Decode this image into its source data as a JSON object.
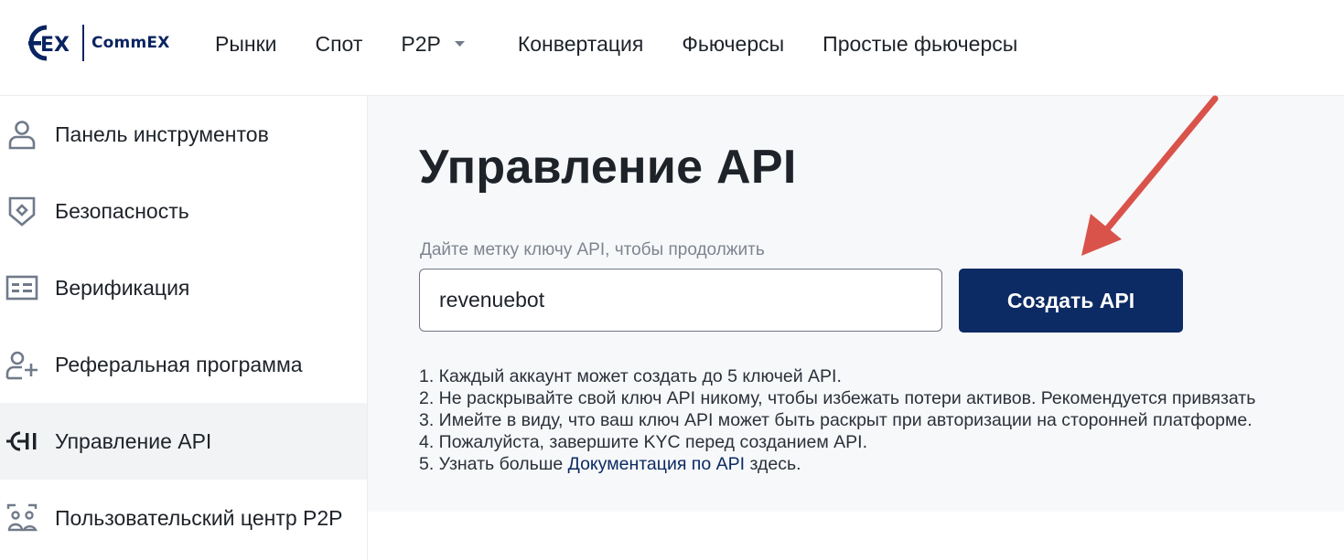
{
  "brand": {
    "logo_text": "CommEX",
    "logo_mark": "EX"
  },
  "nav": {
    "items": [
      "Рынки",
      "Спот",
      "P2P",
      "Конвертация",
      "Фьючерсы",
      "Простые фьючерсы"
    ]
  },
  "sidebar": {
    "items": [
      {
        "label": "Панель инструментов",
        "icon": "user-icon"
      },
      {
        "label": "Безопасность",
        "icon": "shield-icon"
      },
      {
        "label": "Верификация",
        "icon": "id-card-icon"
      },
      {
        "label": "Реферальная программа",
        "icon": "user-plus-icon"
      },
      {
        "label": "Управление API",
        "icon": "api-icon",
        "active": true
      },
      {
        "label": "Пользовательский центр P2P",
        "icon": "p2p-users-icon"
      }
    ]
  },
  "main": {
    "title": "Управление API",
    "field_label": "Дайте метку ключу API, чтобы продолжить",
    "input_value": "revenuebot",
    "create_button": "Создать API",
    "notes": [
      "1. Каждый аккаунт может создать до 5 ключей API.",
      "2. Не раскрывайте свой ключ API никому, чтобы избежать потери активов. Рекомендуется привязать",
      "3. Имейте в виду, что ваш ключ API может быть раскрыт при авторизации на сторонней платформе.",
      "4. Пожалуйста, завершите KYC перед созданием API."
    ],
    "note5_prefix": "5. Узнать больше ",
    "note5_link": "Документация по API",
    "note5_suffix": " здесь."
  },
  "colors": {
    "brand_navy": "#0c2a63",
    "annotation_arrow": "#d9534a",
    "active_sidebar_bg": "#f2f3f5",
    "main_bg": "#f7f8fa"
  }
}
